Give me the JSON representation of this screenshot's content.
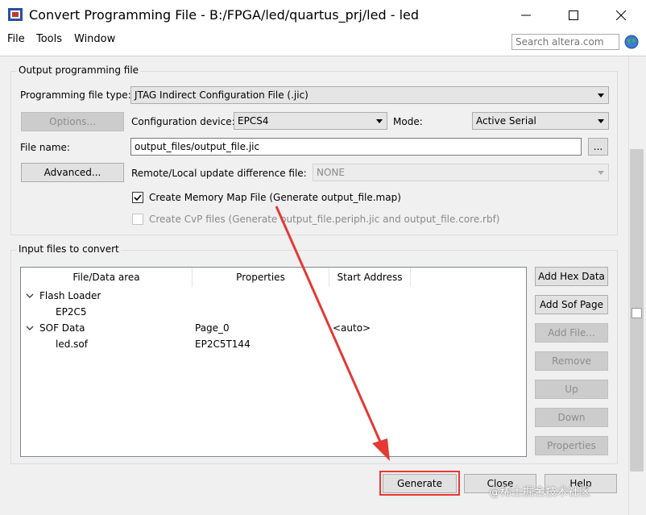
{
  "window": {
    "title": "Convert Programming File - B:/FPGA/led/quartus_prj/led - led"
  },
  "menu": {
    "items": [
      "File",
      "Tools",
      "Window"
    ]
  },
  "search": {
    "placeholder": "Search altera.com"
  },
  "output_group": {
    "label": "Output programming file",
    "file_type_label": "Programming file type:",
    "file_type_value": "JTAG Indirect Configuration File (.jic)",
    "options_button": "Options...",
    "config_device_label": "Configuration device:",
    "config_device_value": "EPCS4",
    "mode_label": "Mode:",
    "mode_value": "Active Serial",
    "file_name_label": "File name:",
    "file_name_value": "output_files/output_file.jic",
    "browse_button": "...",
    "advanced_button": "Advanced...",
    "remote_label": "Remote/Local update difference file:",
    "remote_value": "NONE",
    "memory_map_label": "Create Memory Map File (Generate output_file.map)",
    "memory_map_checked": true,
    "cvp_label": "Create CvP files (Generate output_file.periph.jic and output_file.core.rbf)",
    "cvp_checked": false
  },
  "input_group": {
    "label": "Input files to convert",
    "columns": [
      "File/Data area",
      "Properties",
      "Start Address"
    ],
    "rows": [
      {
        "name": "Flash Loader",
        "properties": "",
        "start": "",
        "level": 0,
        "expanded": true
      },
      {
        "name": "EP2C5",
        "properties": "",
        "start": "",
        "level": 1
      },
      {
        "name": "SOF Data",
        "properties": "Page_0",
        "start": "<auto>",
        "level": 0,
        "expanded": true
      },
      {
        "name": "led.sof",
        "properties": "EP2C5T144",
        "start": "",
        "level": 1
      }
    ],
    "buttons": {
      "add_hex": "Add Hex Data",
      "add_sof": "Add Sof Page",
      "add_file": "Add File...",
      "remove": "Remove",
      "up": "Up",
      "down": "Down",
      "properties": "Properties"
    }
  },
  "footer": {
    "generate": "Generate",
    "close": "Close",
    "help": "Help"
  },
  "watermark": "@稀土掘金技术社区",
  "colors": {
    "annotation": "#e53935"
  }
}
